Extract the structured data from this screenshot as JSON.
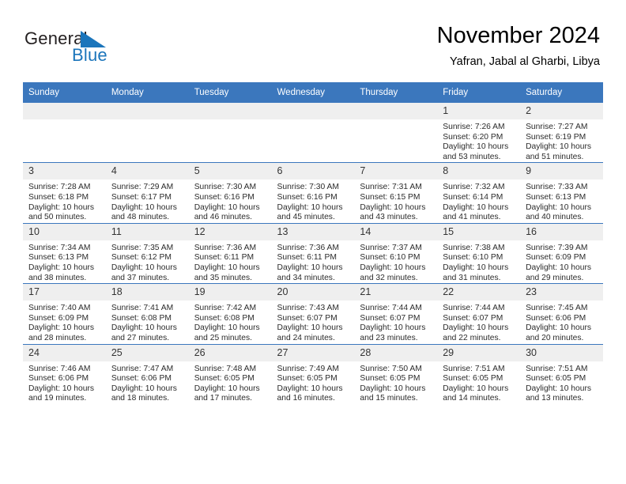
{
  "logo": {
    "word1": "General",
    "word2": "Blue",
    "triangle_color": "#1b75bb",
    "text_color": "#231f20"
  },
  "header": {
    "title": "November 2024",
    "subtitle": "Yafran, Jabal al Gharbi, Libya"
  },
  "theme": {
    "header_band": "#3b77bd",
    "daynum_band": "#efefef",
    "page_background": "#ffffff"
  },
  "weekday_headers": [
    "Sunday",
    "Monday",
    "Tuesday",
    "Wednesday",
    "Thursday",
    "Friday",
    "Saturday"
  ],
  "weeks": [
    [
      {
        "day": "",
        "empty": true,
        "lines": []
      },
      {
        "day": "",
        "empty": true,
        "lines": []
      },
      {
        "day": "",
        "empty": true,
        "lines": []
      },
      {
        "day": "",
        "empty": true,
        "lines": []
      },
      {
        "day": "",
        "empty": true,
        "lines": []
      },
      {
        "day": "1",
        "empty": false,
        "lines": [
          "Sunrise: 7:26 AM",
          "Sunset: 6:20 PM",
          "Daylight: 10 hours",
          "and 53 minutes."
        ]
      },
      {
        "day": "2",
        "empty": false,
        "lines": [
          "Sunrise: 7:27 AM",
          "Sunset: 6:19 PM",
          "Daylight: 10 hours",
          "and 51 minutes."
        ]
      }
    ],
    [
      {
        "day": "3",
        "empty": false,
        "lines": [
          "Sunrise: 7:28 AM",
          "Sunset: 6:18 PM",
          "Daylight: 10 hours",
          "and 50 minutes."
        ]
      },
      {
        "day": "4",
        "empty": false,
        "lines": [
          "Sunrise: 7:29 AM",
          "Sunset: 6:17 PM",
          "Daylight: 10 hours",
          "and 48 minutes."
        ]
      },
      {
        "day": "5",
        "empty": false,
        "lines": [
          "Sunrise: 7:30 AM",
          "Sunset: 6:16 PM",
          "Daylight: 10 hours",
          "and 46 minutes."
        ]
      },
      {
        "day": "6",
        "empty": false,
        "lines": [
          "Sunrise: 7:30 AM",
          "Sunset: 6:16 PM",
          "Daylight: 10 hours",
          "and 45 minutes."
        ]
      },
      {
        "day": "7",
        "empty": false,
        "lines": [
          "Sunrise: 7:31 AM",
          "Sunset: 6:15 PM",
          "Daylight: 10 hours",
          "and 43 minutes."
        ]
      },
      {
        "day": "8",
        "empty": false,
        "lines": [
          "Sunrise: 7:32 AM",
          "Sunset: 6:14 PM",
          "Daylight: 10 hours",
          "and 41 minutes."
        ]
      },
      {
        "day": "9",
        "empty": false,
        "lines": [
          "Sunrise: 7:33 AM",
          "Sunset: 6:13 PM",
          "Daylight: 10 hours",
          "and 40 minutes."
        ]
      }
    ],
    [
      {
        "day": "10",
        "empty": false,
        "lines": [
          "Sunrise: 7:34 AM",
          "Sunset: 6:13 PM",
          "Daylight: 10 hours",
          "and 38 minutes."
        ]
      },
      {
        "day": "11",
        "empty": false,
        "lines": [
          "Sunrise: 7:35 AM",
          "Sunset: 6:12 PM",
          "Daylight: 10 hours",
          "and 37 minutes."
        ]
      },
      {
        "day": "12",
        "empty": false,
        "lines": [
          "Sunrise: 7:36 AM",
          "Sunset: 6:11 PM",
          "Daylight: 10 hours",
          "and 35 minutes."
        ]
      },
      {
        "day": "13",
        "empty": false,
        "lines": [
          "Sunrise: 7:36 AM",
          "Sunset: 6:11 PM",
          "Daylight: 10 hours",
          "and 34 minutes."
        ]
      },
      {
        "day": "14",
        "empty": false,
        "lines": [
          "Sunrise: 7:37 AM",
          "Sunset: 6:10 PM",
          "Daylight: 10 hours",
          "and 32 minutes."
        ]
      },
      {
        "day": "15",
        "empty": false,
        "lines": [
          "Sunrise: 7:38 AM",
          "Sunset: 6:10 PM",
          "Daylight: 10 hours",
          "and 31 minutes."
        ]
      },
      {
        "day": "16",
        "empty": false,
        "lines": [
          "Sunrise: 7:39 AM",
          "Sunset: 6:09 PM",
          "Daylight: 10 hours",
          "and 29 minutes."
        ]
      }
    ],
    [
      {
        "day": "17",
        "empty": false,
        "lines": [
          "Sunrise: 7:40 AM",
          "Sunset: 6:09 PM",
          "Daylight: 10 hours",
          "and 28 minutes."
        ]
      },
      {
        "day": "18",
        "empty": false,
        "lines": [
          "Sunrise: 7:41 AM",
          "Sunset: 6:08 PM",
          "Daylight: 10 hours",
          "and 27 minutes."
        ]
      },
      {
        "day": "19",
        "empty": false,
        "lines": [
          "Sunrise: 7:42 AM",
          "Sunset: 6:08 PM",
          "Daylight: 10 hours",
          "and 25 minutes."
        ]
      },
      {
        "day": "20",
        "empty": false,
        "lines": [
          "Sunrise: 7:43 AM",
          "Sunset: 6:07 PM",
          "Daylight: 10 hours",
          "and 24 minutes."
        ]
      },
      {
        "day": "21",
        "empty": false,
        "lines": [
          "Sunrise: 7:44 AM",
          "Sunset: 6:07 PM",
          "Daylight: 10 hours",
          "and 23 minutes."
        ]
      },
      {
        "day": "22",
        "empty": false,
        "lines": [
          "Sunrise: 7:44 AM",
          "Sunset: 6:07 PM",
          "Daylight: 10 hours",
          "and 22 minutes."
        ]
      },
      {
        "day": "23",
        "empty": false,
        "lines": [
          "Sunrise: 7:45 AM",
          "Sunset: 6:06 PM",
          "Daylight: 10 hours",
          "and 20 minutes."
        ]
      }
    ],
    [
      {
        "day": "24",
        "empty": false,
        "lines": [
          "Sunrise: 7:46 AM",
          "Sunset: 6:06 PM",
          "Daylight: 10 hours",
          "and 19 minutes."
        ]
      },
      {
        "day": "25",
        "empty": false,
        "lines": [
          "Sunrise: 7:47 AM",
          "Sunset: 6:06 PM",
          "Daylight: 10 hours",
          "and 18 minutes."
        ]
      },
      {
        "day": "26",
        "empty": false,
        "lines": [
          "Sunrise: 7:48 AM",
          "Sunset: 6:05 PM",
          "Daylight: 10 hours",
          "and 17 minutes."
        ]
      },
      {
        "day": "27",
        "empty": false,
        "lines": [
          "Sunrise: 7:49 AM",
          "Sunset: 6:05 PM",
          "Daylight: 10 hours",
          "and 16 minutes."
        ]
      },
      {
        "day": "28",
        "empty": false,
        "lines": [
          "Sunrise: 7:50 AM",
          "Sunset: 6:05 PM",
          "Daylight: 10 hours",
          "and 15 minutes."
        ]
      },
      {
        "day": "29",
        "empty": false,
        "lines": [
          "Sunrise: 7:51 AM",
          "Sunset: 6:05 PM",
          "Daylight: 10 hours",
          "and 14 minutes."
        ]
      },
      {
        "day": "30",
        "empty": false,
        "lines": [
          "Sunrise: 7:51 AM",
          "Sunset: 6:05 PM",
          "Daylight: 10 hours",
          "and 13 minutes."
        ]
      }
    ]
  ]
}
